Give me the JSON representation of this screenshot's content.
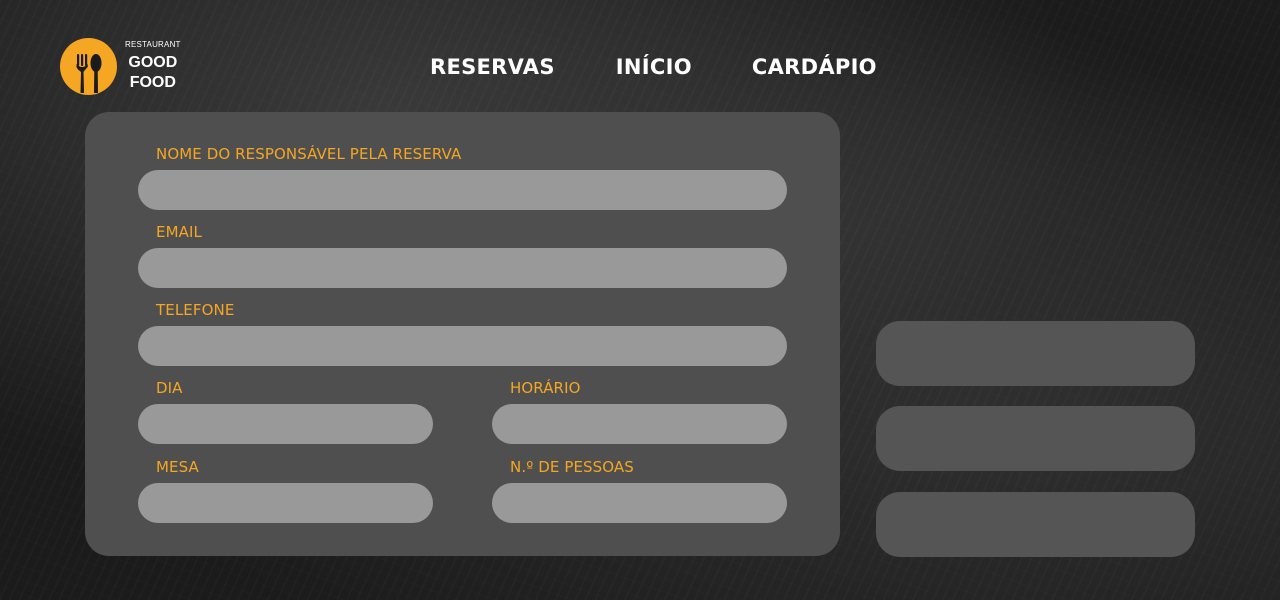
{
  "brand": {
    "small": "RESTAURANT",
    "line1": "GOOD",
    "line2": "FOOD",
    "accent_color": "#f5a623",
    "icon": "fork-spoon-icon"
  },
  "nav": {
    "reservas": "RESERVAS",
    "inicio": "INÍCIO",
    "cardapio": "CARDÁPIO"
  },
  "form": {
    "name": {
      "label": "NOME DO RESPONSÁVEL PELA RESERVA",
      "value": ""
    },
    "email": {
      "label": "EMAIL",
      "value": ""
    },
    "telefone": {
      "label": "TELEFONE",
      "value": ""
    },
    "dia": {
      "label": "DIA",
      "value": ""
    },
    "horario": {
      "label": "HORÁRIO",
      "value": ""
    },
    "mesa": {
      "label": "MESA",
      "value": ""
    },
    "pessoas": {
      "label": "N.º DE PESSOAS",
      "value": ""
    }
  },
  "side_buttons": {
    "button1": "",
    "button2": "",
    "button3": ""
  },
  "colors": {
    "card": "#4f4f4f",
    "input": "#999999",
    "side_button": "#555555",
    "label": "#f5a623"
  }
}
